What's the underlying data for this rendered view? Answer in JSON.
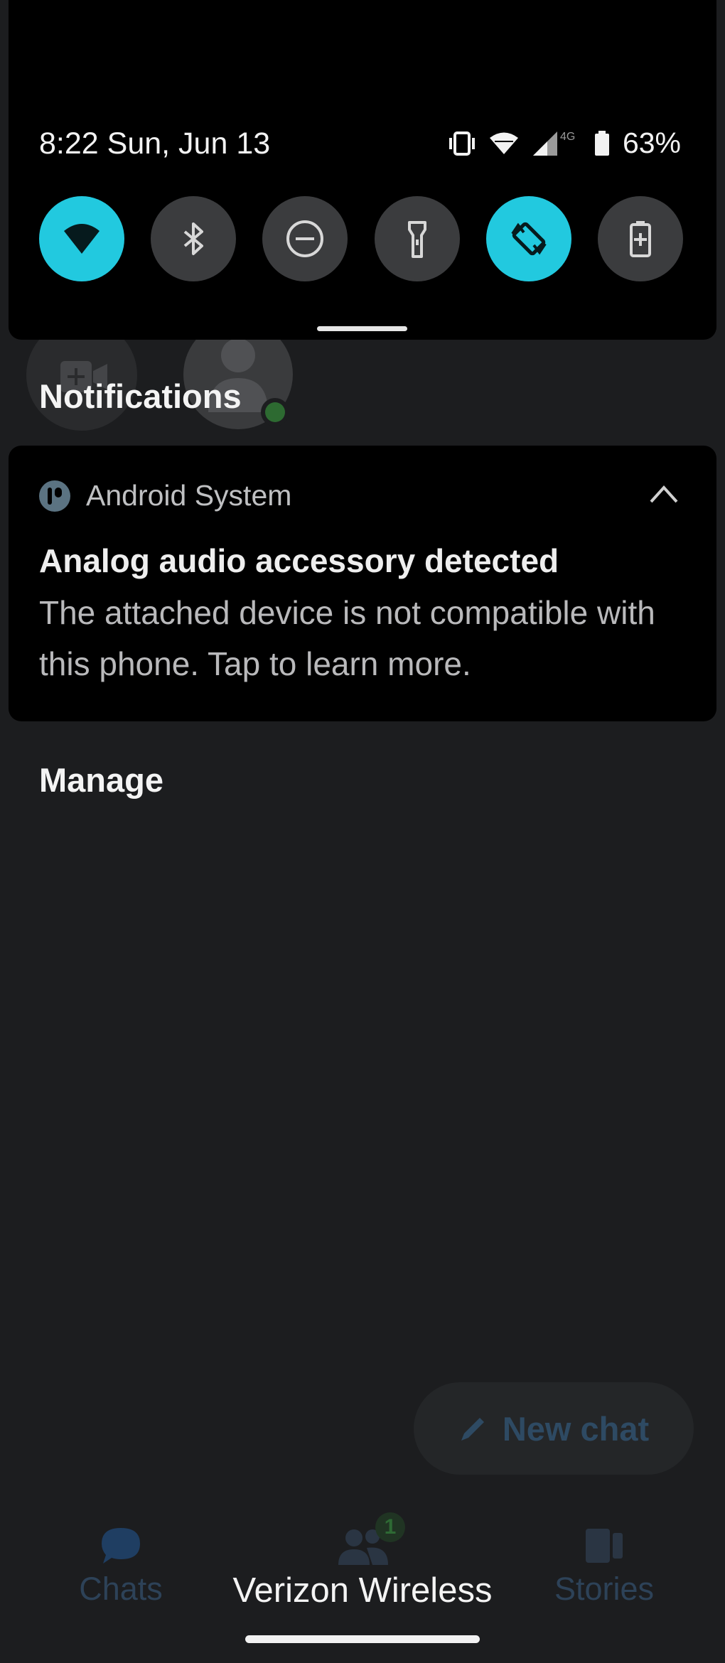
{
  "status_bar": {
    "time_date": "8:22 Sun, Jun 13",
    "network_type": "4G",
    "battery": "63%",
    "icons": [
      "vibrate-icon",
      "wifi-icon",
      "signal-icon",
      "battery-icon"
    ]
  },
  "quick_settings": [
    {
      "name": "wifi",
      "icon": "wifi-icon",
      "on": true
    },
    {
      "name": "bluetooth",
      "icon": "bluetooth-icon",
      "on": false
    },
    {
      "name": "do-not-disturb",
      "icon": "minus-circle-icon",
      "on": false
    },
    {
      "name": "flashlight",
      "icon": "flashlight-icon",
      "on": false
    },
    {
      "name": "auto-rotate",
      "icon": "rotate-icon",
      "on": true
    },
    {
      "name": "battery-saver",
      "icon": "battery-plus-icon",
      "on": false
    }
  ],
  "colors": {
    "accent": "#22c9df",
    "panel": "#000000",
    "background": "#1c1d1f"
  },
  "notifications": {
    "header": "Notifications",
    "items": [
      {
        "app": "Android System",
        "title": "Analog audio accessory detected",
        "body": "The attached device is not compatible with this phone. Tap to learn more."
      }
    ],
    "manage": "Manage"
  },
  "background_app": {
    "fab_label": "New chat",
    "nav": {
      "chats": "Chats",
      "stories": "Stories",
      "people_badge": "1"
    }
  },
  "carrier": "Verizon Wireless"
}
